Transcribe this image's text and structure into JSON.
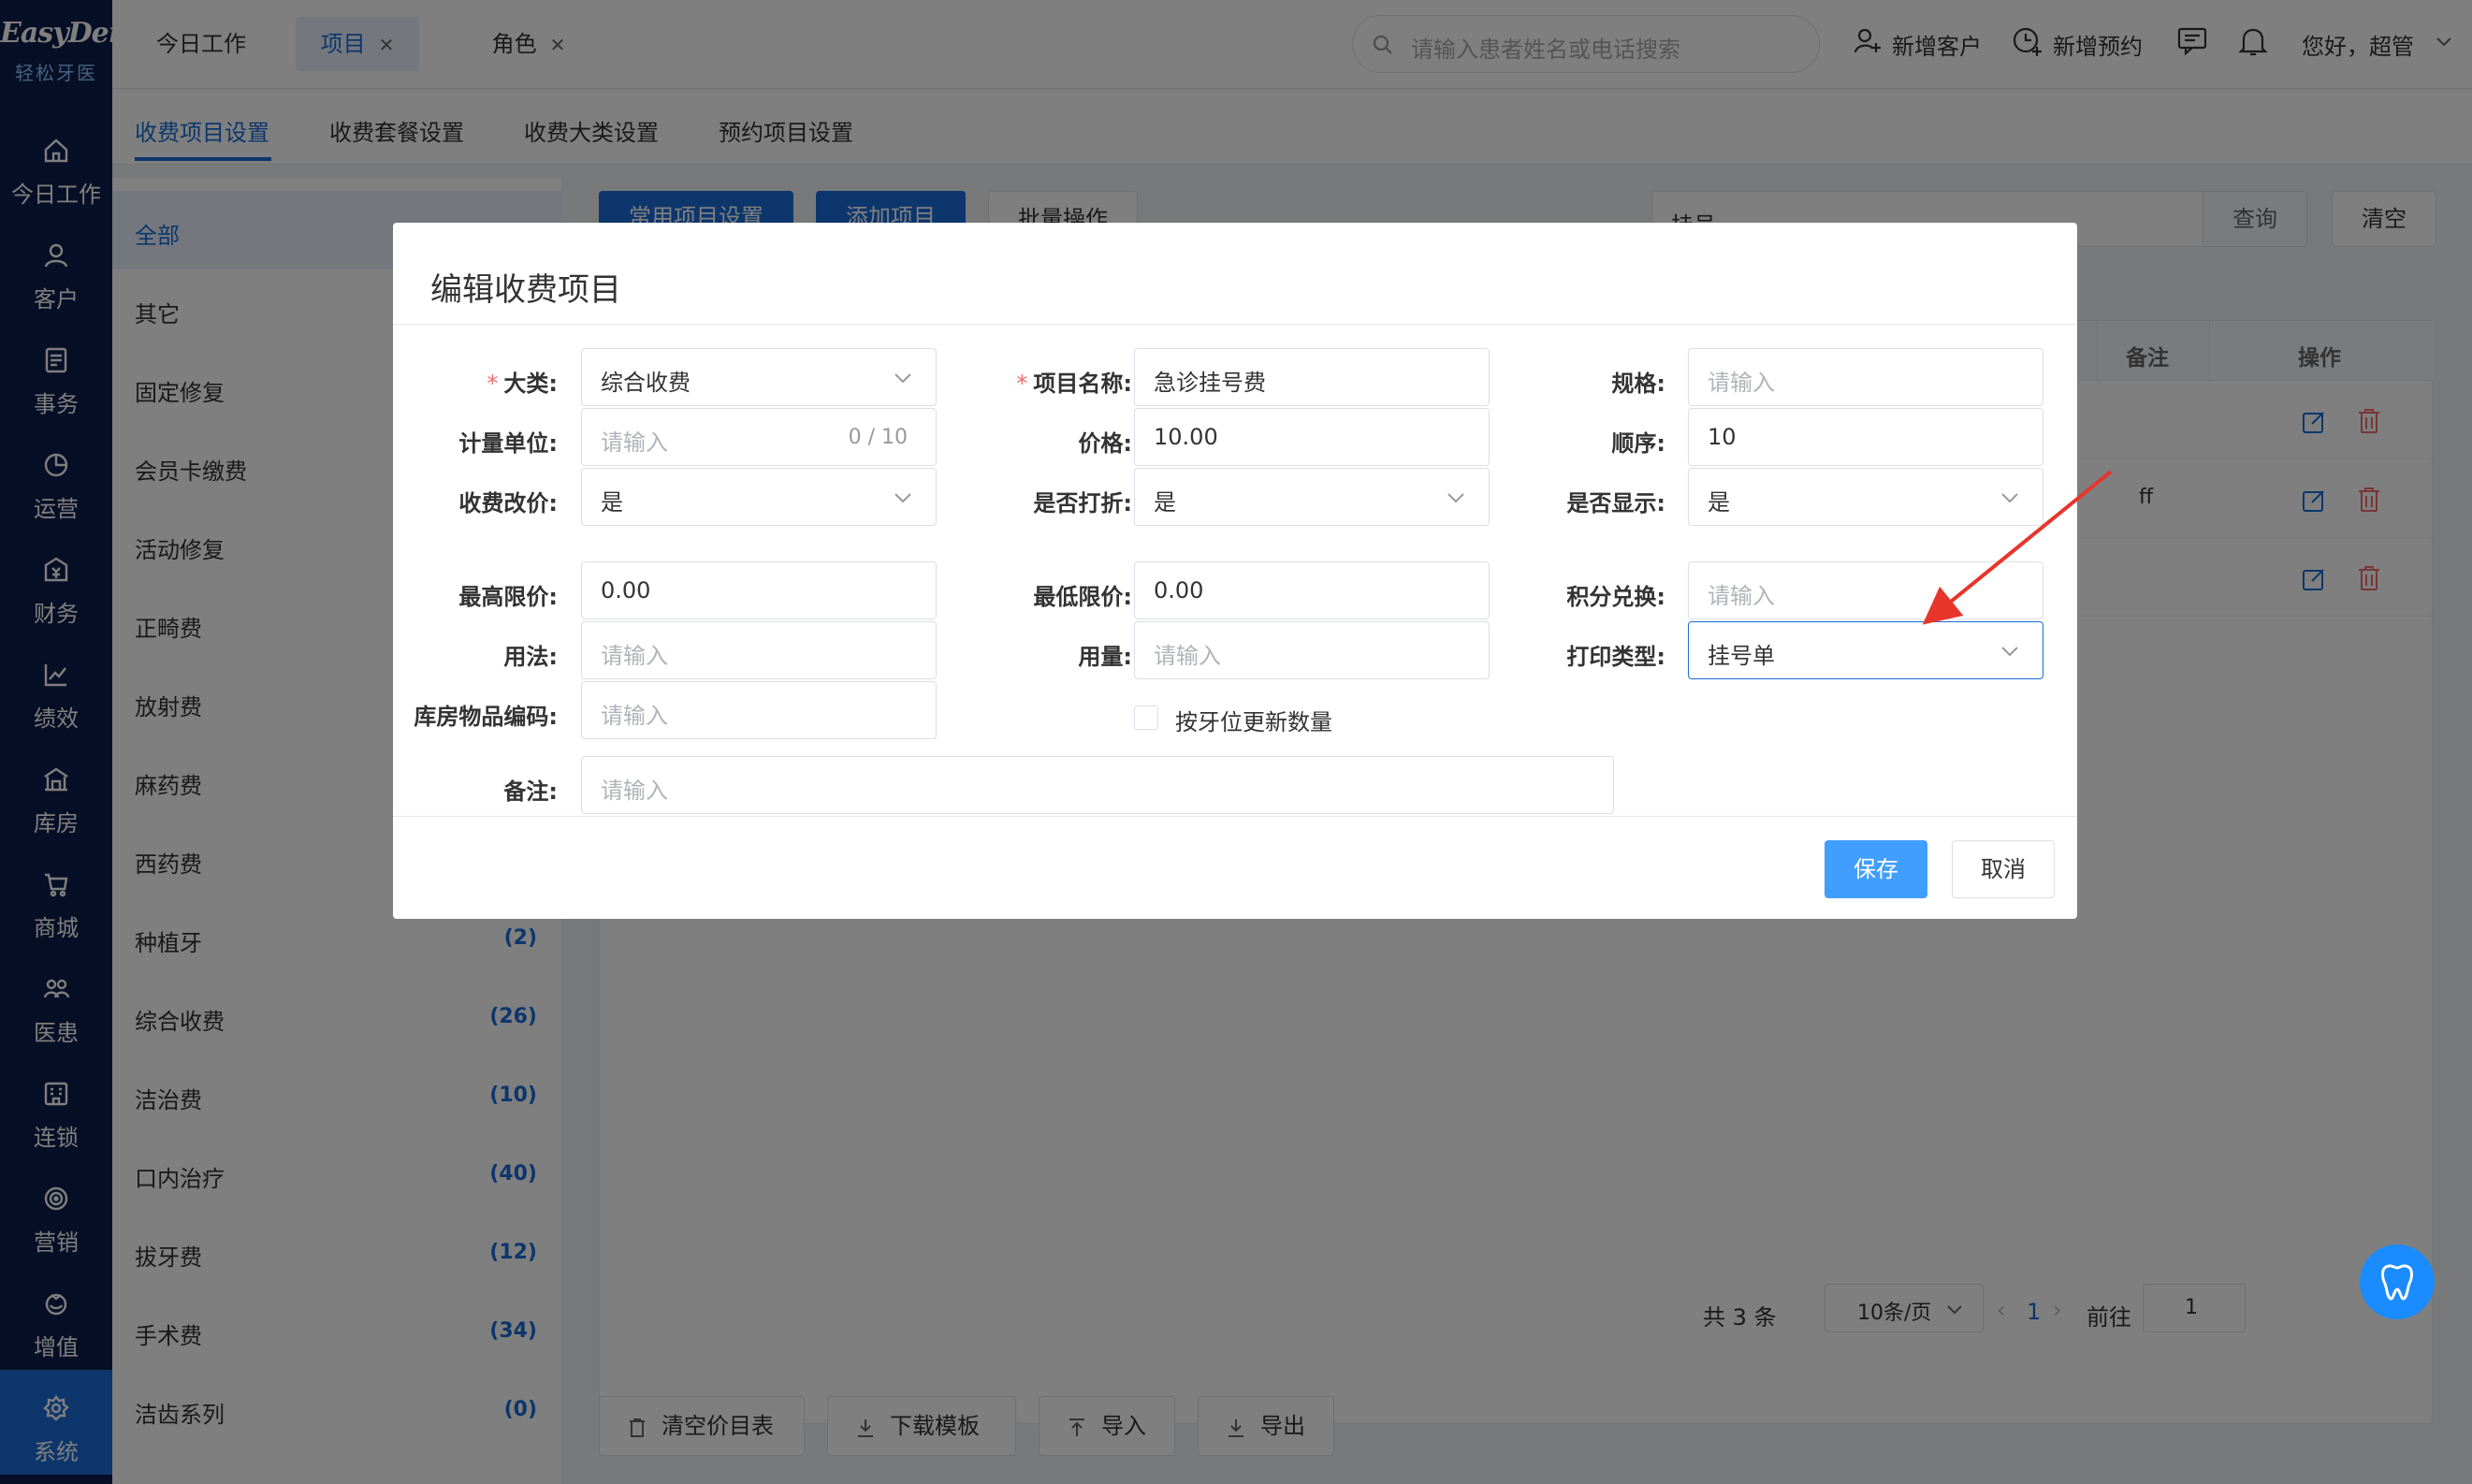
{
  "brand": {
    "name_en": "EasyDent",
    "name_cn": "轻松牙医"
  },
  "nav": [
    {
      "key": "today",
      "label": "今日工作",
      "icon": "home-icon"
    },
    {
      "key": "customer",
      "label": "客户",
      "icon": "user-icon"
    },
    {
      "key": "affairs",
      "label": "事务",
      "icon": "document-icon"
    },
    {
      "key": "ops",
      "label": "运营",
      "icon": "pie-icon"
    },
    {
      "key": "finance",
      "label": "财务",
      "icon": "money-icon"
    },
    {
      "key": "perf",
      "label": "绩效",
      "icon": "chart-line-icon"
    },
    {
      "key": "storage",
      "label": "库房",
      "icon": "warehouse-icon"
    },
    {
      "key": "mall",
      "label": "商城",
      "icon": "cart-icon"
    },
    {
      "key": "patient",
      "label": "医患",
      "icon": "people-icon"
    },
    {
      "key": "chain",
      "label": "连锁",
      "icon": "building-icon"
    },
    {
      "key": "marketing",
      "label": "营销",
      "icon": "target-icon"
    },
    {
      "key": "value",
      "label": "增值",
      "icon": "gift-icon"
    },
    {
      "key": "system",
      "label": "系统",
      "icon": "gear-icon"
    }
  ],
  "tabs": [
    {
      "label": "今日工作",
      "closable": false
    },
    {
      "label": "项目",
      "closable": true
    },
    {
      "label": "角色",
      "closable": true
    }
  ],
  "header": {
    "search_placeholder": "请输入患者姓名或电话搜索",
    "new_customer": "新增客户",
    "new_appointment": "新增预约",
    "greeting": "您好，超管"
  },
  "subtabs": [
    "收费项目设置",
    "收费套餐设置",
    "收费大类设置",
    "预约项目设置"
  ],
  "categories": [
    {
      "name": "全部",
      "count": ""
    },
    {
      "name": "其它",
      "count": ""
    },
    {
      "name": "固定修复",
      "count": ""
    },
    {
      "name": "会员卡缴费",
      "count": ""
    },
    {
      "name": "活动修复",
      "count": ""
    },
    {
      "name": "正畸费",
      "count": ""
    },
    {
      "name": "放射费",
      "count": ""
    },
    {
      "name": "麻药费",
      "count": ""
    },
    {
      "name": "西药费",
      "count": ""
    },
    {
      "name": "种植牙",
      "count": "(2)"
    },
    {
      "name": "综合收费",
      "count": "(26)"
    },
    {
      "name": "洁治费",
      "count": "(10)"
    },
    {
      "name": "口内治疗",
      "count": "(40)"
    },
    {
      "name": "拔牙费",
      "count": "(12)"
    },
    {
      "name": "手术费",
      "count": "(34)"
    },
    {
      "name": "洁齿系列",
      "count": "(0)"
    }
  ],
  "toolbar": {
    "common_settings": "常用项目设置",
    "add_item": "添加项目",
    "batch": "批量操作",
    "filter_value": "挂号",
    "query": "查询",
    "clear": "清空"
  },
  "table": {
    "col_remark": "备注",
    "col_actions": "操作",
    "rows": [
      {
        "remark": ""
      },
      {
        "remark": "ff"
      },
      {
        "remark": ""
      }
    ]
  },
  "pagination": {
    "total": "共 3 条",
    "page_size": "10条/页",
    "current": "1",
    "goto_label": "前往",
    "goto_value": "1"
  },
  "bottom_buttons": [
    "清空价目表",
    "下载模板",
    "导入",
    "导出"
  ],
  "modal": {
    "title": "编辑收费项目",
    "fields": {
      "category": {
        "label": "大类:",
        "value": "综合收费"
      },
      "name": {
        "label": "项目名称:",
        "value": "急诊挂号费"
      },
      "spec": {
        "label": "规格:",
        "placeholder": "请输入"
      },
      "unit": {
        "label": "计量单位:",
        "placeholder": "请输入",
        "counter": "0 / 10"
      },
      "price": {
        "label": "价格:",
        "value": "10.00"
      },
      "order": {
        "label": "顺序:",
        "value": "10"
      },
      "price_change": {
        "label": "收费改价:",
        "value": "是"
      },
      "discount": {
        "label": "是否打折:",
        "value": "是"
      },
      "display": {
        "label": "是否显示:",
        "value": "是"
      },
      "max_price": {
        "label": "最高限价:",
        "value": "0.00"
      },
      "min_price": {
        "label": "最低限价:",
        "value": "0.00"
      },
      "points": {
        "label": "积分兑换:",
        "placeholder": "请输入"
      },
      "usage": {
        "label": "用法:",
        "placeholder": "请输入"
      },
      "dosage": {
        "label": "用量:",
        "placeholder": "请输入"
      },
      "print_type": {
        "label": "打印类型:",
        "value": "挂号单"
      },
      "stock_code": {
        "label": "库房物品编码:",
        "placeholder": "请输入"
      },
      "remark": {
        "label": "备注:",
        "placeholder": "请输入"
      }
    },
    "checkbox_label": "按牙位更新数量",
    "save": "保存",
    "cancel": "取消"
  },
  "colors": {
    "primary": "#1a6dd8",
    "nav_bg": "#0d1f4a",
    "save": "#409eff",
    "arrow": "#e8352c",
    "danger": "#f56c6c"
  }
}
